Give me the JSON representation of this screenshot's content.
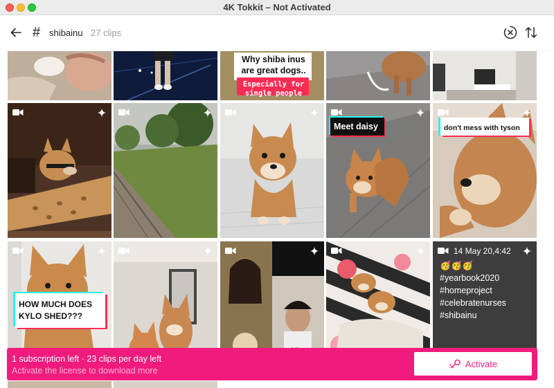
{
  "window": {
    "title": "4K Tokkit – Not Activated"
  },
  "toolbar": {
    "hash": "#",
    "tag": "shibainu",
    "count": "27 clips"
  },
  "captions": {
    "why_title": "Why shiba inus are great dogs..",
    "why_sub": "Especially for single people",
    "meet": "Meet daisy",
    "mess": "don't mess with tyson",
    "kylo": "HOW MUCH DOES KYLO SHED???"
  },
  "post": {
    "date": "14 May 20,4:42",
    "emoji": "🥳🥳🥳",
    "tags": [
      "#yearbook2020",
      "#homeproject",
      "#celebratenurses",
      "#shibainu"
    ]
  },
  "banner": {
    "line1": "1 subscription left  ·  23 clips per day left",
    "line2": "Activate the license to download more",
    "button": "Activate"
  },
  "colors": {
    "accent": "#f01b7d",
    "tiktok_cyan": "#25f4ee",
    "tiktok_red": "#fe2c55"
  }
}
